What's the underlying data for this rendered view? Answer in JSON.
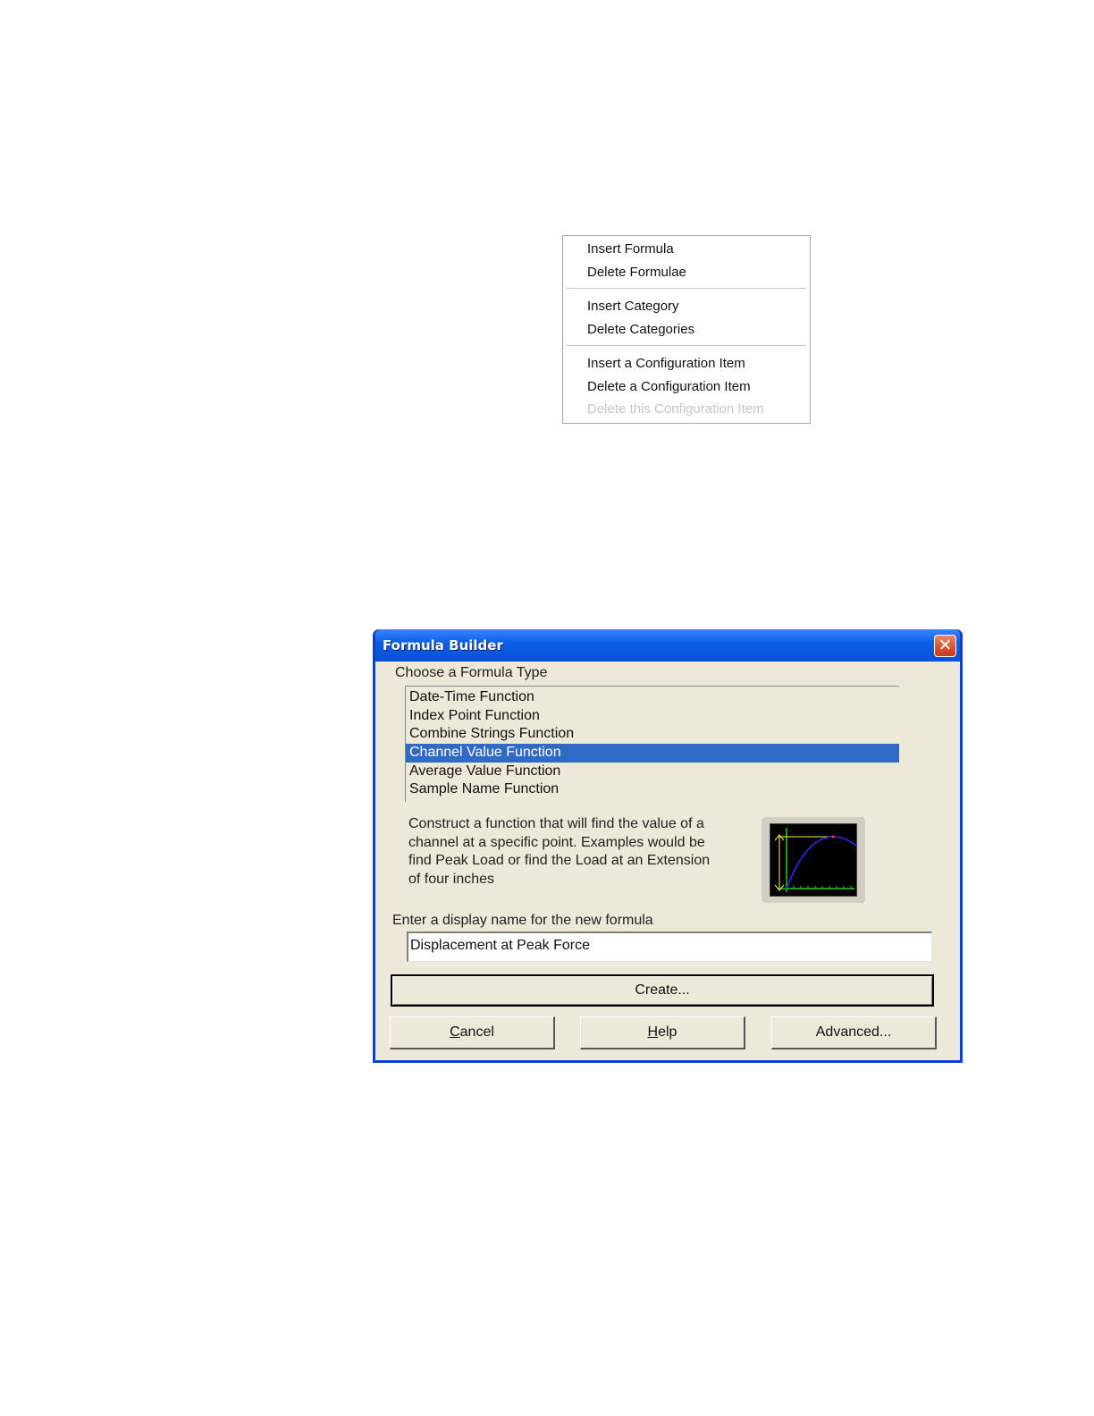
{
  "context_menu": {
    "items": [
      {
        "label": "Insert Formula",
        "enabled": true
      },
      {
        "label": "Delete Formulae",
        "enabled": true
      },
      {
        "label": "Insert Category",
        "enabled": true
      },
      {
        "label": "Delete Categories",
        "enabled": true
      },
      {
        "label": "Insert a Configuration Item",
        "enabled": true
      },
      {
        "label": "Delete a Configuration Item",
        "enabled": true
      },
      {
        "label": "Delete this Configuration Item",
        "enabled": false
      }
    ]
  },
  "dialog": {
    "title": "Formula Builder",
    "close_glyph": "✕",
    "formula_type_label": "Choose a Formula Type",
    "formula_types": [
      "Date-Time Function",
      "Index Point Function",
      "Combine Strings Function",
      "Channel Value Function",
      "Average Value Function",
      "Sample Name Function"
    ],
    "selected_type": "Channel Value Function",
    "description": "Construct a function that will find the value of a channel at a specific point. Examples would be find Peak Load or find the Load at an Extension of four inches",
    "preview_icon": "channel-value-graph-icon",
    "display_name_label": "Enter a display name for the new formula",
    "display_name_value": "Displacement at Peak Force",
    "create_label": "Create...",
    "cancel_label_first": "C",
    "cancel_label_rest": "ancel",
    "help_label_first": "H",
    "help_label_rest": "elp",
    "advanced_label": "Advanced..."
  },
  "colors": {
    "titlebar": "#0a4fd4",
    "selection": "#316ac5",
    "dialog_face": "#ece9d8",
    "close_button": "#d8502e",
    "preview_grid": "#22cc22",
    "preview_curve": "#2a2aff",
    "preview_marker": "#ffee44"
  }
}
